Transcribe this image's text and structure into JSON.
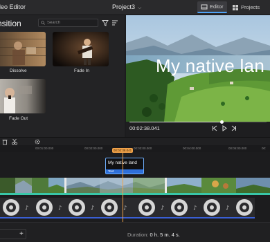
{
  "app": {
    "title": "ideo Editor",
    "project": "Project3"
  },
  "nav": {
    "editor": "Editor",
    "projects": "Projects"
  },
  "panel": {
    "title": "nsition",
    "search_placeholder": "Search",
    "items": [
      {
        "label": "Dissolve"
      },
      {
        "label": "Fade In"
      },
      {
        "label": "Fade Out"
      }
    ]
  },
  "preview": {
    "overlay_text": "My native lan",
    "timecode": "00:02:38.041",
    "progress": 0.68
  },
  "timeline": {
    "ticks": [
      "00:01:00.000",
      "00:02:00.000",
      "00:03:00.000",
      "00:04:00.000",
      "00:05:00.000",
      "00:"
    ],
    "playhead": "00:02:38.041",
    "text_clip": {
      "title": "My native land",
      "kind": "Text"
    }
  },
  "footer": {
    "duration_label": "Duration:",
    "duration_value": "0 h. 5 m. 4 s."
  },
  "colors": {
    "accent": "#4fa3f7",
    "playhead": "#f0a24a",
    "video_bar": "#39c7a8",
    "audio_rail": "#3a5fd4"
  }
}
